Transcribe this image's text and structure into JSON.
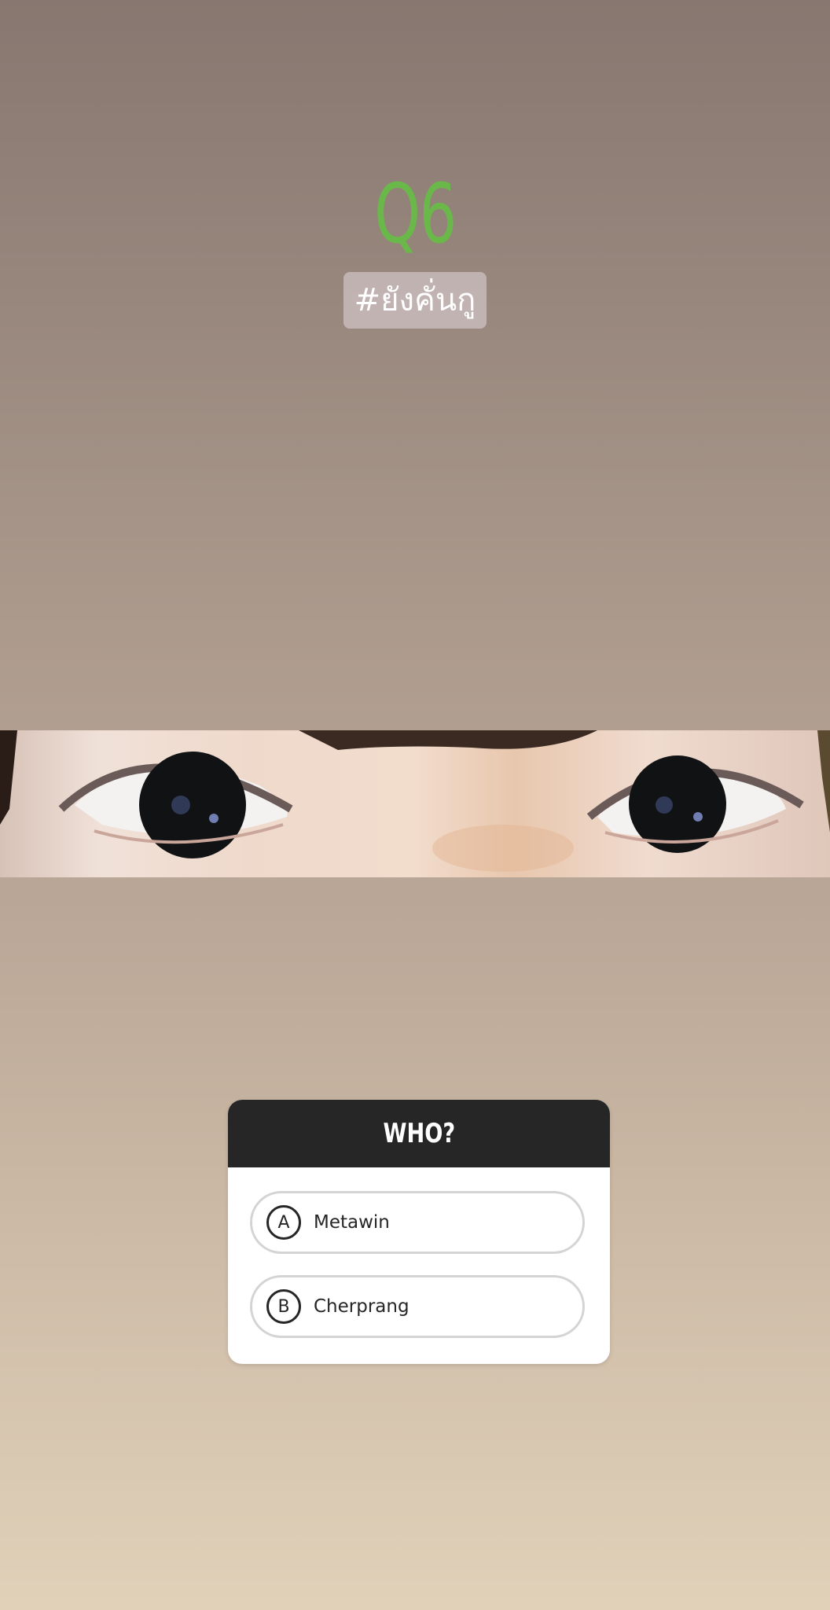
{
  "story": {
    "question_number": "Q6",
    "hashtag": "#ยังคั่นกู"
  },
  "photo": {
    "subject": "eyes-photo"
  },
  "quiz": {
    "title": "WHO?",
    "options": [
      {
        "letter": "A",
        "label": "Metawin"
      },
      {
        "letter": "B",
        "label": "Cherprang"
      }
    ]
  },
  "colors": {
    "question_number": "#6bb84a",
    "quiz_header": "#262626"
  }
}
